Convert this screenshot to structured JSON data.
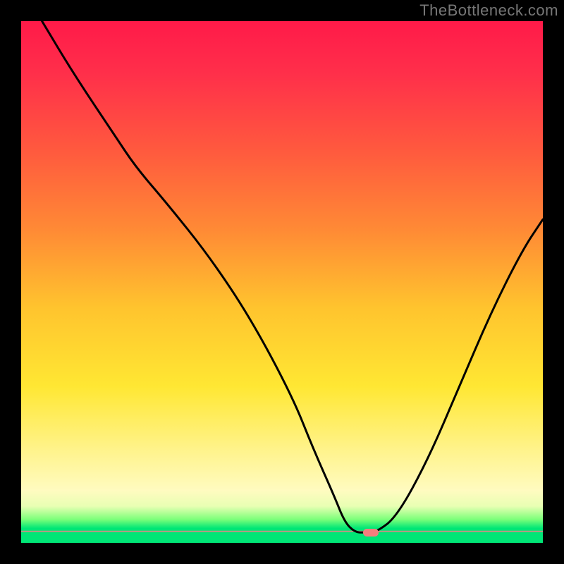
{
  "watermark": "TheBottleneck.com",
  "colors": {
    "curve_stroke": "#000000",
    "blob": "#f77d7d"
  },
  "chart_data": {
    "type": "line",
    "title": "",
    "xlabel": "",
    "ylabel": "",
    "xlim": [
      0,
      100
    ],
    "ylim": [
      0,
      100
    ],
    "grid": false,
    "legend": false,
    "note": "Plot-area local coordinates: x 0–100 left→right, y 0–100 bottom→top. Values estimated from pixels.",
    "series": [
      {
        "name": "bottleneck-curve",
        "x": [
          4,
          10,
          18,
          22,
          28,
          36,
          44,
          52,
          56,
          60,
          62,
          64,
          66,
          68,
          72,
          78,
          84,
          90,
          96,
          100
        ],
        "y": [
          100,
          90,
          78,
          72,
          65,
          55,
          43,
          28,
          18,
          9,
          4,
          2,
          2,
          2,
          5,
          16,
          30,
          44,
          56,
          62
        ]
      }
    ],
    "valley_marker": {
      "x": 67,
      "y": 2
    }
  }
}
